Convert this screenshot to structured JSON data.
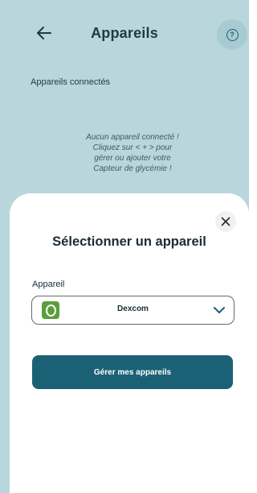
{
  "header": {
    "title": "Appareils",
    "back_icon": "arrow-left-icon",
    "help_icon": "question-circle-icon",
    "help_glyph": "?"
  },
  "connected": {
    "label": "Appareils connectés",
    "empty_lines": [
      "Aucun appareil connecté !",
      "Cliquez sur < + > pour",
      "gérer ou ajouter votre",
      "Capteur de glycémie !"
    ]
  },
  "sheet": {
    "title": "Sélectionner un appareil",
    "close_icon": "close-icon",
    "field_label": "Appareil",
    "selected_device": "Dexcom",
    "device_icon": "dexcom-logo-icon",
    "chevron_icon": "chevron-down-icon",
    "manage_button": "Gérer mes appareils"
  },
  "colors": {
    "background": "#b9d6dc",
    "primary": "#1b6175",
    "device_logo": "#5b9f3c"
  }
}
